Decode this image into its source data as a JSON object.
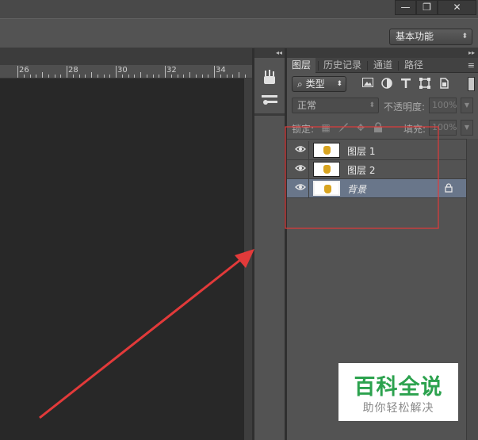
{
  "window": {
    "minimize_glyph": "—",
    "maximize_glyph": "❐",
    "close_glyph": "✕"
  },
  "options_bar": {
    "workspace_label": "基本功能",
    "workspace_arrow": "⬍"
  },
  "ruler": {
    "ticks": [
      "26",
      "28",
      "30",
      "32",
      "34"
    ]
  },
  "collapse_glyph": "◂◂",
  "expand_glyph": "▸▸",
  "left_strip": {
    "icons": [
      "brush-presets-icon",
      "tool-presets-icon"
    ]
  },
  "layers_panel": {
    "tabs": [
      "图层",
      "历史记录",
      "通道",
      "路径"
    ],
    "active_tab": "图层",
    "menu_glyph": "≡",
    "filter": {
      "label": "类型",
      "search_glyph": "⌕",
      "arrow": "⬍",
      "icons": [
        "image-filter-icon",
        "adjustment-filter-icon",
        "type-filter-icon",
        "shape-filter-icon",
        "smart-object-filter-icon"
      ]
    },
    "blend_mode": "正常",
    "opacity_label": "不透明度:",
    "opacity_value": "100%",
    "lock_label": "锁定:",
    "fill_label": "填充:",
    "fill_value": "100%",
    "layers": [
      {
        "name": "图层 1",
        "visible": true,
        "selected": false,
        "locked": false
      },
      {
        "name": "图层 2",
        "visible": true,
        "selected": false,
        "locked": false
      },
      {
        "name": "背景",
        "visible": true,
        "selected": true,
        "locked": true
      }
    ]
  },
  "watermark": {
    "title": "百科全说",
    "subtitle": "助你轻松解决"
  },
  "colors": {
    "selection": "#69768a",
    "annotation_red": "#e23a3a",
    "watermark_green": "#2ca24e"
  }
}
